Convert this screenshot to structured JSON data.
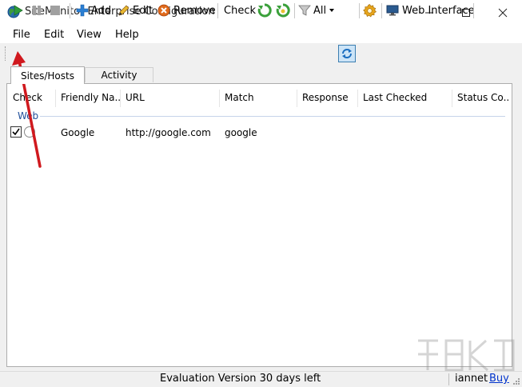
{
  "window": {
    "title": "SiteMonitor Enterprise Configuration",
    "controls": [
      "minimize",
      "maximize",
      "close"
    ]
  },
  "menubar": {
    "items": [
      "File",
      "Edit",
      "View",
      "Help"
    ]
  },
  "toolbar": {
    "add_label": "Add",
    "edit_label": "Edit",
    "remove_label": "Remove",
    "check_label": "Check",
    "filter_label": "All",
    "web_interface_label": "Web Interface"
  },
  "tabs": [
    {
      "label": "Sites/Hosts",
      "active": true
    },
    {
      "label": "Activity",
      "active": false
    }
  ],
  "table": {
    "columns": [
      "Check",
      "Friendly Na...",
      "URL",
      "Match",
      "Response",
      "Last Checked",
      "Status Co..."
    ],
    "groups": [
      {
        "name": "Web",
        "rows": [
          {
            "checked": true,
            "friendly_name": "Google",
            "url": "http://google.com",
            "match": "google",
            "response": "",
            "last_checked": "",
            "status": ""
          }
        ]
      }
    ]
  },
  "statusbar": {
    "message": "Evaluation Version 30 days left",
    "user": "iannet",
    "buy_label": "Buy"
  },
  "colors": {
    "accent_blue": "#1f4e9a",
    "annotation_arrow": "#d0191e",
    "link": "#0033cc"
  }
}
